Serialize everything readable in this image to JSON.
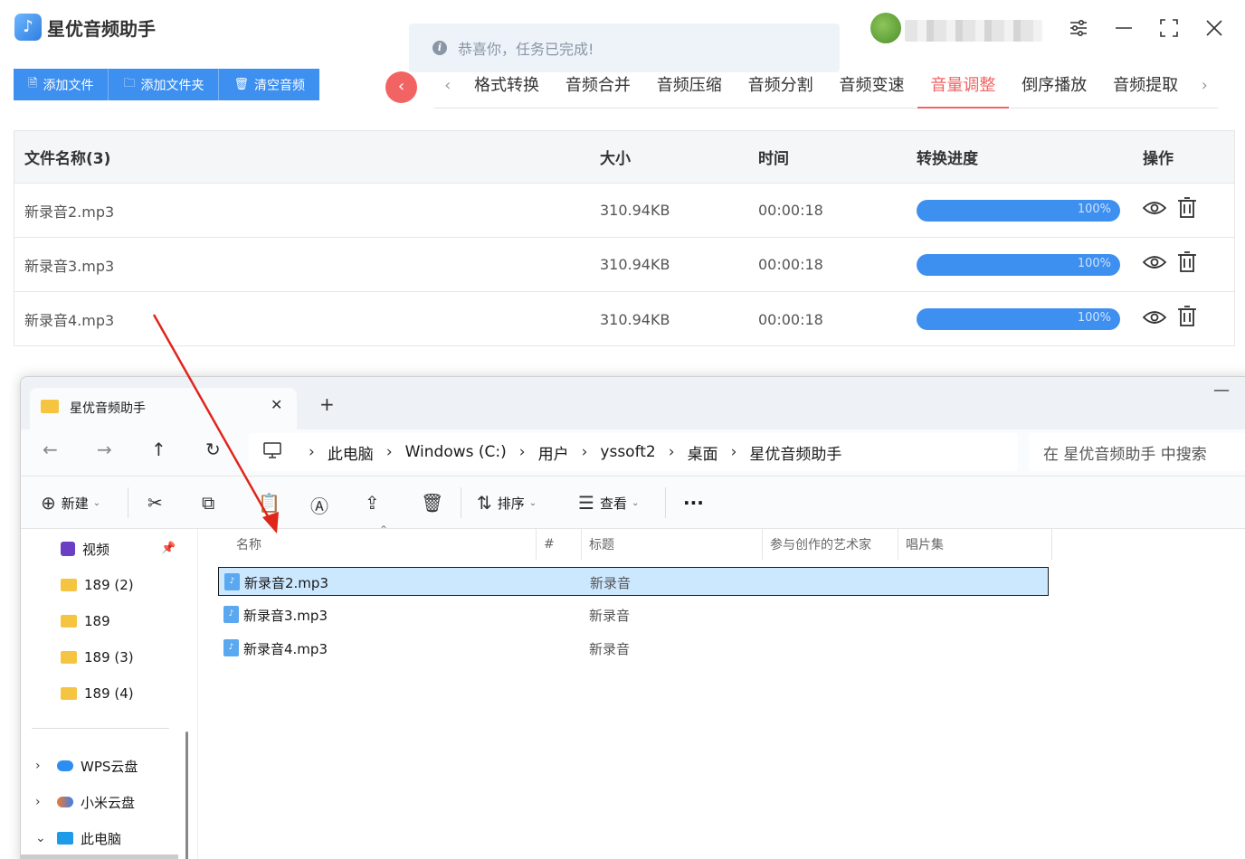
{
  "app": {
    "title": "星优音频助手",
    "logo_icon": "music-note-icon"
  },
  "toast": {
    "message": "恭喜你，任务已完成!"
  },
  "window_controls": {
    "settings": "☰",
    "minimize": "—",
    "maximize": "⛶",
    "close": "✕"
  },
  "toolbar": {
    "add_file": "添加文件",
    "add_folder": "添加文件夹",
    "clear_audio": "清空音频"
  },
  "tabs": [
    {
      "label": "格式转换"
    },
    {
      "label": "音频合并"
    },
    {
      "label": "音频压缩"
    },
    {
      "label": "音频分割"
    },
    {
      "label": "音频变速"
    },
    {
      "label": "音量调整"
    },
    {
      "label": "倒序播放"
    },
    {
      "label": "音频提取"
    }
  ],
  "active_tab": "音量调整",
  "accent_color": "#f26464",
  "primary_color": "#3d8ff0",
  "file_table": {
    "headers": {
      "name": "文件名称(3)",
      "size": "大小",
      "time": "时间",
      "progress": "转换进度",
      "ops": "操作"
    },
    "rows": [
      {
        "name": "新录音2.mp3",
        "size": "310.94KB",
        "time": "00:00:18",
        "progress": "100%"
      },
      {
        "name": "新录音3.mp3",
        "size": "310.94KB",
        "time": "00:00:18",
        "progress": "100%"
      },
      {
        "name": "新录音4.mp3",
        "size": "310.94KB",
        "time": "00:00:18",
        "progress": "100%"
      }
    ]
  },
  "explorer": {
    "tab_title": "星优音频助手",
    "new_tab": "+",
    "breadcrumb": [
      "此电脑",
      "Windows (C:)",
      "用户",
      "yssoft2",
      "桌面",
      "星优音频助手"
    ],
    "search_placeholder": "在 星优音频助手 中搜索",
    "commands": {
      "new": "新建",
      "sort": "排序",
      "view": "查看",
      "more": "···"
    },
    "nav_items": [
      {
        "label": "视频"
      },
      {
        "label": "189 (2)"
      },
      {
        "label": "189"
      },
      {
        "label": "189 (3)"
      },
      {
        "label": "189 (4)"
      },
      {
        "label": "WPS云盘"
      },
      {
        "label": "小米云盘"
      },
      {
        "label": "此电脑"
      }
    ],
    "columns": {
      "name": "名称",
      "number": "#",
      "title": "标题",
      "artist": "参与创作的艺术家",
      "album": "唱片集"
    },
    "files": [
      {
        "name": "新录音2.mp3",
        "title": "新录音",
        "selected": true
      },
      {
        "name": "新录音3.mp3",
        "title": "新录音",
        "selected": false
      },
      {
        "name": "新录音4.mp3",
        "title": "新录音",
        "selected": false
      }
    ]
  }
}
